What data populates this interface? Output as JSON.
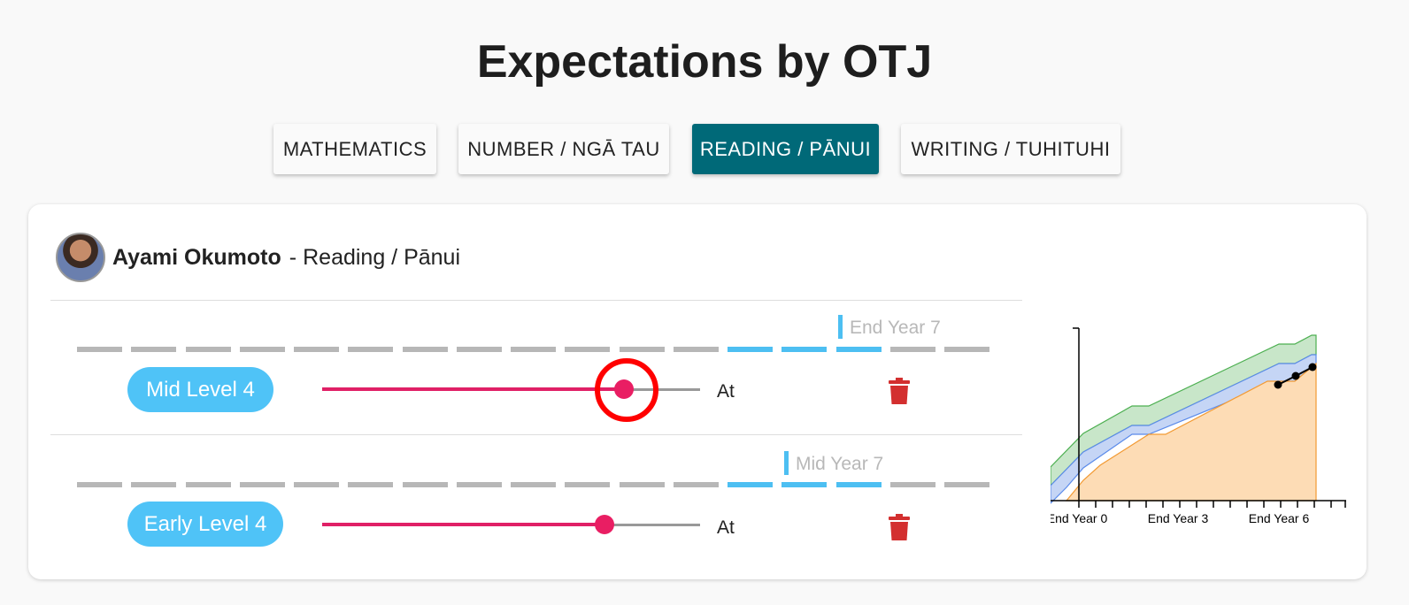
{
  "page": {
    "title": "Expectations by OTJ"
  },
  "tabs": [
    {
      "label": "MATHEMATICS",
      "active": false
    },
    {
      "label": "NUMBER / NGĀ TAU",
      "active": false
    },
    {
      "label": "READING / PĀNUI",
      "active": true
    },
    {
      "label": "WRITING / TUHITUHI",
      "active": false
    }
  ],
  "student": {
    "name": "Ayami Okumoto",
    "separator": "-",
    "subject": "Reading / Pānui"
  },
  "judgements": [
    {
      "level": "Mid Level 4",
      "marker_label": "End Year 7",
      "status": "At",
      "slider_value": 0.8,
      "highlighted": true
    },
    {
      "level": "Early Level 4",
      "marker_label": "Mid Year 7",
      "status": "At",
      "slider_value": 0.75,
      "highlighted": false
    }
  ],
  "colors": {
    "accent": "#006978",
    "pill": "#4fc3f7",
    "slider": "#e91e63",
    "tick_active": "#4dbff2",
    "tick_inactive": "#b7b7b7",
    "trash": "#d32f2f",
    "band_top": "#c8e6c9",
    "band_mid": "#c5d5f5",
    "band_base": "#fddcb5"
  },
  "icons": {
    "delete": "trash-icon"
  },
  "chart_data": {
    "type": "area",
    "x_ticks": [
      "End Year 0",
      "End Year 3",
      "End Year 6"
    ],
    "series": [
      {
        "values": []
      }
    ],
    "student_points": []
  }
}
